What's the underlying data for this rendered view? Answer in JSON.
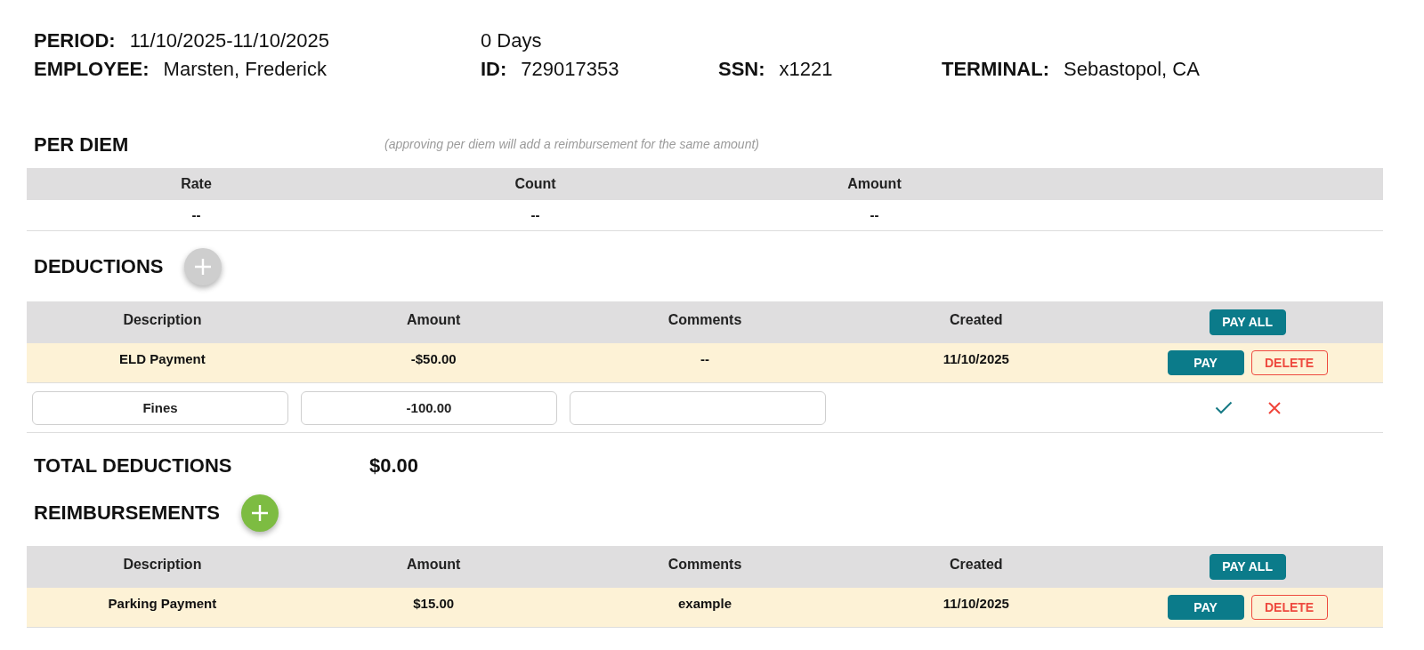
{
  "summary": {
    "rows": [
      [
        {
          "label": "PERIOD:",
          "value": "11/10/2025-11/10/2025"
        },
        {
          "value": "0 Days"
        }
      ],
      [
        {
          "label": "EMPLOYEE:",
          "value": "Marsten, Frederick"
        },
        {
          "label": "ID:",
          "value": "729017353"
        },
        {
          "label": "SSN:",
          "value": "x1221"
        },
        {
          "label": "TERMINAL:",
          "value": "Sebastopol, CA"
        }
      ]
    ]
  },
  "per_diem": {
    "title": "PER DIEM",
    "note": "(approving per diem will add a reimbursement for the same amount)",
    "columns": [
      "Rate",
      "Count",
      "Amount"
    ],
    "rows": [
      [
        "--",
        "--",
        "--"
      ]
    ]
  },
  "deductions": {
    "title": "DEDUCTIONS",
    "add_button": {
      "disabled": true
    },
    "columns": [
      "Description",
      "Amount",
      "Comments",
      "Created"
    ],
    "pay_all_button": {
      "kind": "primary",
      "label": "PAY ALL"
    },
    "rows": [
      {
        "highlighted": true,
        "cells": [
          "ELD Payment",
          "-$50.00",
          "--",
          "11/10/2025"
        ],
        "buttons": [
          {
            "kind": "primary",
            "label": "PAY"
          },
          {
            "kind": "danger",
            "label": "DELETE"
          }
        ]
      }
    ],
    "new_row": {
      "fields": [
        {
          "kind": "input",
          "value": "Fines"
        },
        {
          "kind": "input",
          "value": "-100.00"
        },
        {
          "kind": "input"
        }
      ]
    }
  },
  "total_deductions": {
    "label": "TOTAL DEDUCTIONS",
    "value": "$0.00"
  },
  "reimbursements": {
    "title": "REIMBURSEMENTS",
    "add_button": {
      "disabled": false
    },
    "columns": [
      "Description",
      "Amount",
      "Comments",
      "Created"
    ],
    "pay_all_button": {
      "kind": "primary",
      "label": "PAY ALL"
    },
    "rows": [
      {
        "highlighted": true,
        "cells": [
          "Parking Payment",
          "$15.00",
          "example",
          "11/10/2025"
        ],
        "buttons": [
          {
            "kind": "primary",
            "label": "PAY"
          },
          {
            "kind": "danger",
            "label": "DELETE"
          }
        ]
      }
    ]
  }
}
